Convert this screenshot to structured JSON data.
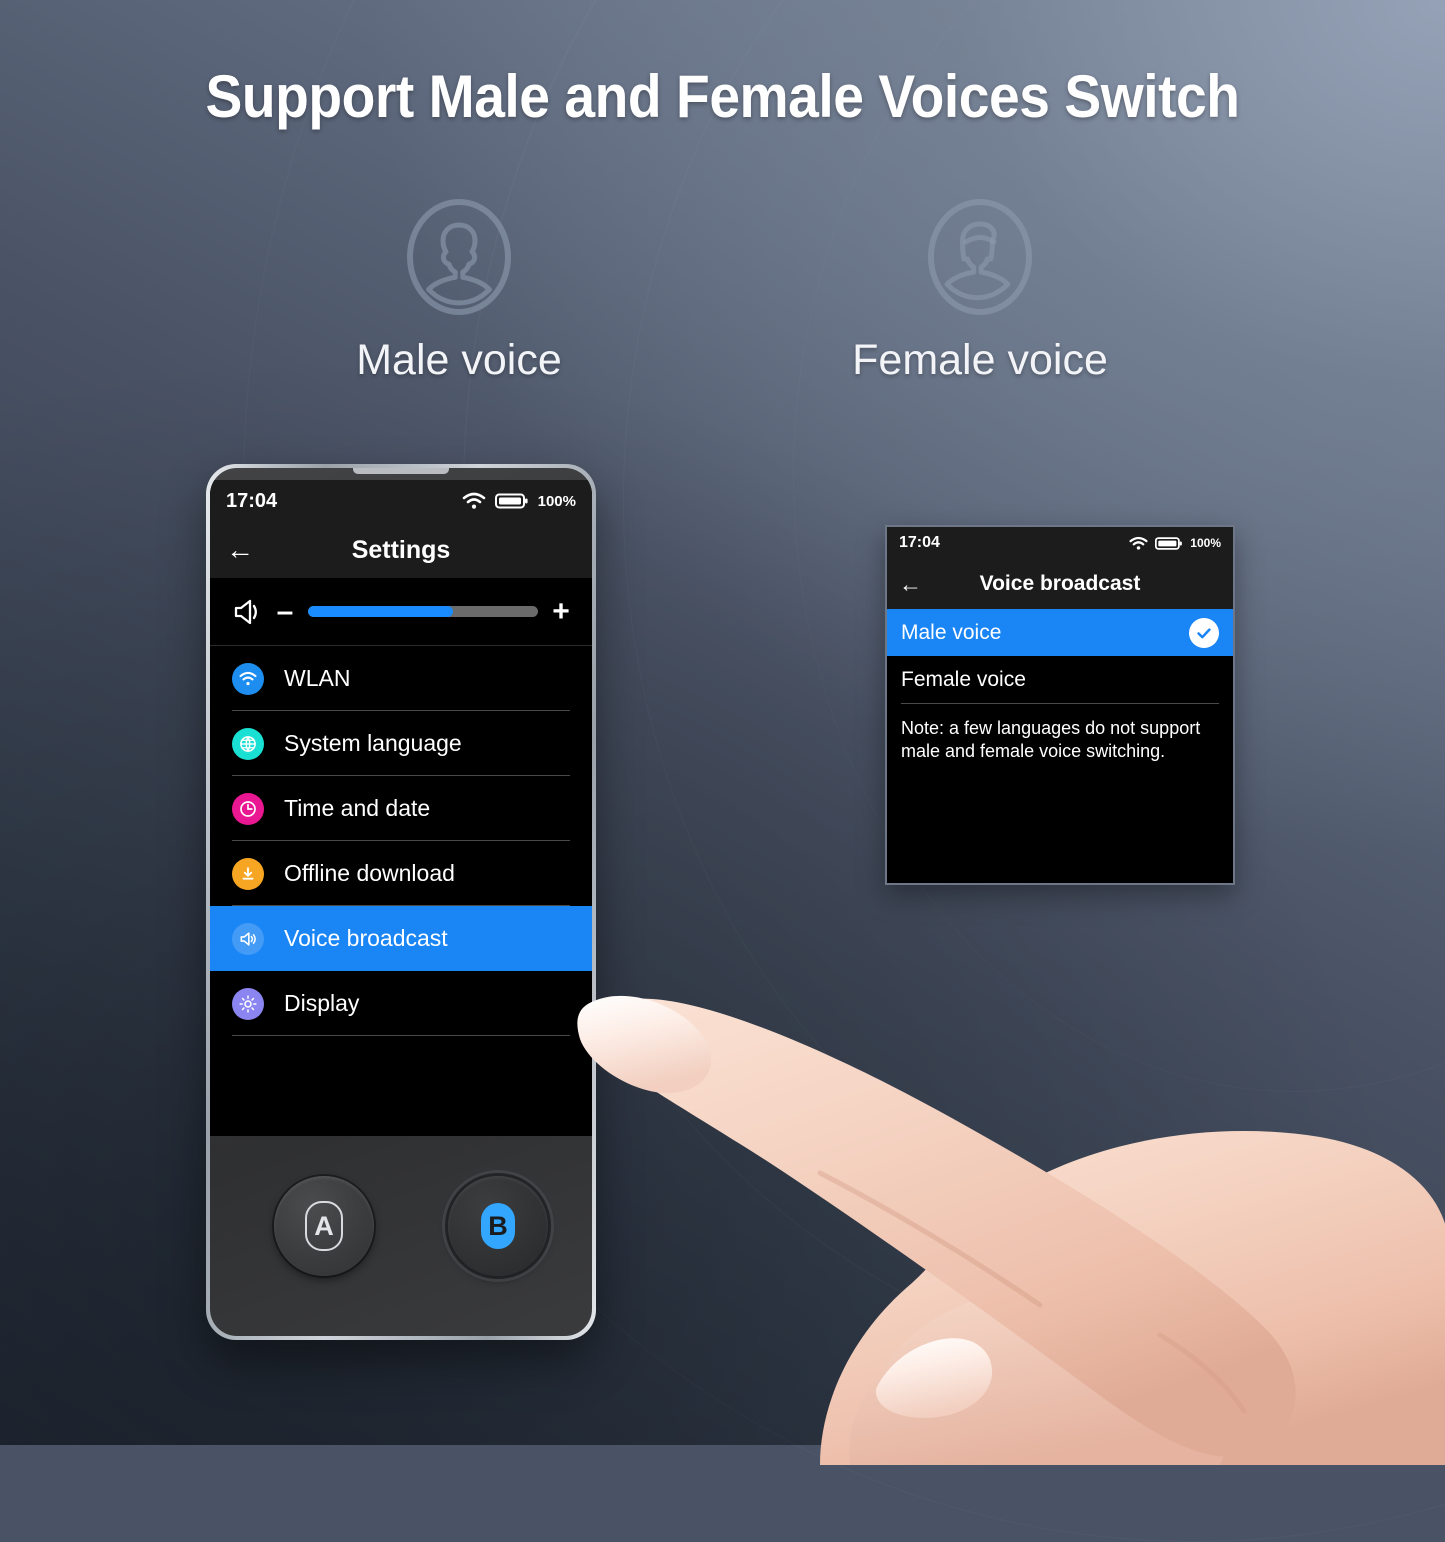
{
  "headline": "Support Male and Female Voices Switch",
  "voices": [
    {
      "label": "Male voice",
      "icon": "male-avatar-icon"
    },
    {
      "label": "Female voice",
      "icon": "female-avatar-icon"
    }
  ],
  "phone": {
    "status": {
      "time": "17:04",
      "wifi_icon": "wifi-icon",
      "battery_icon": "battery-full-icon",
      "battery_level": "100%"
    },
    "titlebar": {
      "back_icon": "back-arrow-icon",
      "title": "Settings"
    },
    "volume": {
      "speaker_icon": "speaker-icon",
      "decrease_label": "–",
      "increase_label": "+",
      "level_percent": 63
    },
    "settings_items": [
      {
        "label": "WLAN",
        "icon": "wifi-icon",
        "color": "#1d8ef0",
        "selected": false
      },
      {
        "label": "System language",
        "icon": "globe-icon",
        "color": "#19e0d2",
        "selected": false
      },
      {
        "label": "Time and date",
        "icon": "clock-icon",
        "color": "#ea1792",
        "selected": false
      },
      {
        "label": "Offline download",
        "icon": "download-icon",
        "color": "#f6a623",
        "selected": false
      },
      {
        "label": "Voice broadcast",
        "icon": "speaker-icon",
        "color": "#4ea5f5",
        "selected": true
      },
      {
        "label": "Display",
        "icon": "brightness-icon",
        "color": "#8a85f0",
        "selected": false
      }
    ],
    "buttons": [
      {
        "label": "A",
        "style": "outline"
      },
      {
        "label": "B",
        "style": "filled"
      }
    ]
  },
  "panel": {
    "status": {
      "time": "17:04",
      "wifi_icon": "wifi-icon",
      "battery_icon": "battery-full-icon",
      "battery_level": "100%"
    },
    "titlebar": {
      "back_icon": "back-arrow-icon",
      "title": "Voice broadcast"
    },
    "options": [
      {
        "label": "Male voice",
        "selected": true,
        "check_icon": "check-circle-icon"
      },
      {
        "label": "Female voice",
        "selected": false,
        "check_icon": null
      }
    ],
    "note": "Note: a few languages do not support male and female voice switching."
  },
  "colors": {
    "accent_blue": "#1a85f5",
    "slider_blue": "#1a8cff",
    "screen_black": "#000000",
    "bar_dark": "#1c1c1c",
    "headline_white": "#ffffff"
  }
}
